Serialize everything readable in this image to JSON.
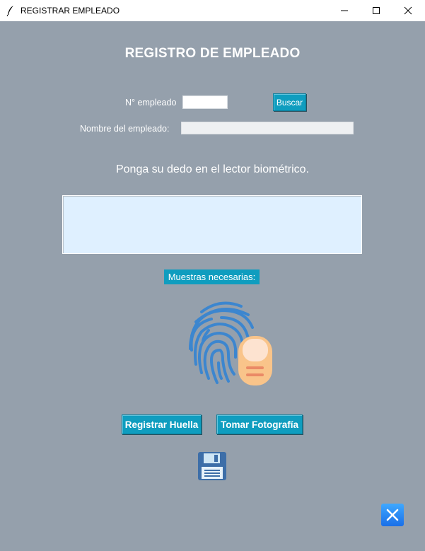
{
  "window": {
    "title": "REGISTRAR EMPLEADO",
    "app_icon": "feather-icon"
  },
  "form": {
    "heading": "REGISTRO DE EMPLEADO",
    "employee_number_label": "N° empleado",
    "employee_number_value": "",
    "search_button": "Buscar",
    "employee_name_label": "Nombre del empleado:",
    "employee_name_value": "",
    "instruction": "Ponga su dedo en el lector biométrico.",
    "log_text": "",
    "samples_label": "Muestras necesarias:"
  },
  "actions": {
    "register_fingerprint": "Registrar Huella",
    "take_photo": "Tomar Fotografía",
    "save_icon": "floppy-disk-icon",
    "exit_icon": "close-x-icon"
  },
  "colors": {
    "background": "#95a0ac",
    "accent": "#0f9dbf",
    "log_area": "#dff0ff"
  }
}
